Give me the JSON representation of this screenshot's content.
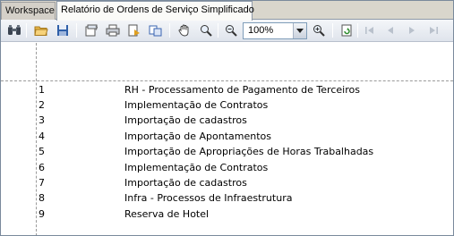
{
  "tabs": [
    {
      "label": "Workspace"
    },
    {
      "label": "Relatório de Ordens de Serviço Simplificado"
    }
  ],
  "toolbar": {
    "zoom_value": "100%"
  },
  "report": {
    "rows": [
      {
        "num": "1",
        "desc": "RH - Processamento de Pagamento de Terceiros"
      },
      {
        "num": "2",
        "desc": "Implementação de Contratos"
      },
      {
        "num": "3",
        "desc": "Importação de cadastros"
      },
      {
        "num": "4",
        "desc": "Importação de Apontamentos"
      },
      {
        "num": "5",
        "desc": "Importação de Apropriações de Horas Trabalhadas"
      },
      {
        "num": "6",
        "desc": "Implementação de Contratos"
      },
      {
        "num": "7",
        "desc": "Importação de cadastros"
      },
      {
        "num": "8",
        "desc": "Infra - Processos de Infraestrutura"
      },
      {
        "num": "9",
        "desc": "Reserva de Hotel"
      }
    ]
  }
}
